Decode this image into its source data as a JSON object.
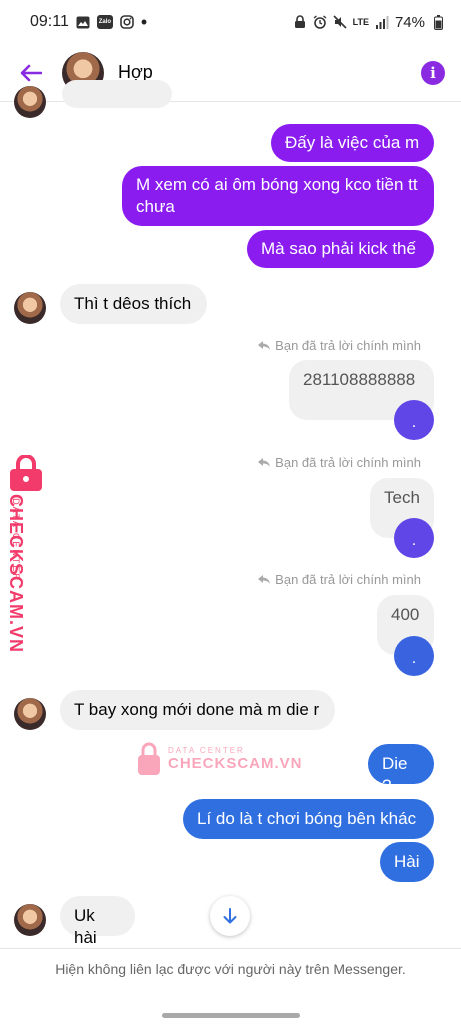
{
  "status_bar": {
    "time": "09:11",
    "zalo": "Zalo",
    "dot": "•",
    "network": "LTE",
    "battery": "74%"
  },
  "header": {
    "contact_name": "Hợp"
  },
  "messages": {
    "m1": "Đấy là việc của m",
    "m2": "M xem có ai ôm bóng xong kco tiền tt chưa",
    "m3": "Mà sao phải kick thế",
    "m4": "Thì t dêos thích",
    "reply_note_1": "Bạn đã trả lời chính mình",
    "q1": "281108888888",
    "r1": ".",
    "reply_note_2": "Bạn đã trả lời chính mình",
    "q2": "Tech",
    "r2": ".",
    "reply_note_3": "Bạn đã trả lời chính mình",
    "q3": "400",
    "r3": ".",
    "m5": "T bay xong mới done mà m die r",
    "m6": "Die ?",
    "m7": "Lí do là t chơi bóng bên khác",
    "m8": "Hài",
    "m9": "Uk hài"
  },
  "watermark": {
    "brand": "CHECKSCAM.VN",
    "sub": "DATA CENTER",
    "center_sub": "DATA CENTER",
    "center_brand": "CHECKSCAM.VN"
  },
  "footer": {
    "notice": "Hiện không liên lạc được với người này trên Messenger."
  },
  "colors": {
    "accent": "#8a2be2",
    "outgoing_purple": "#8a1cf0",
    "outgoing_blue": "#2f6fe0",
    "watermark": "#f23b6a"
  }
}
